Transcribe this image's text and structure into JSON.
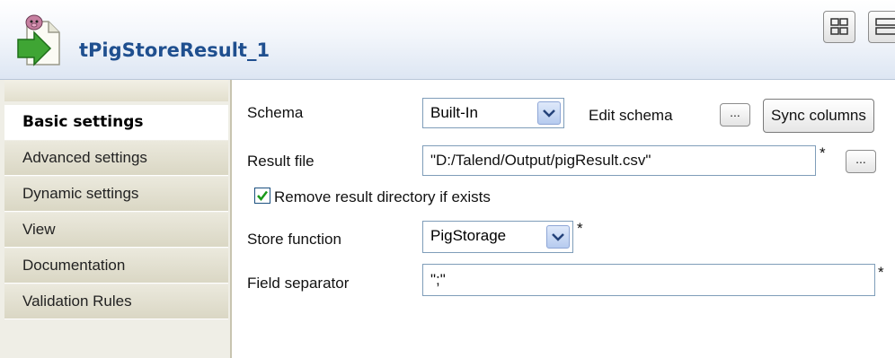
{
  "header": {
    "title": "tPigStoreResult_1",
    "icon": "pig-store-result-icon"
  },
  "sidebar": {
    "tabs": [
      {
        "label": "Basic settings",
        "active": true
      },
      {
        "label": "Advanced settings",
        "active": false
      },
      {
        "label": "Dynamic settings",
        "active": false
      },
      {
        "label": "View",
        "active": false
      },
      {
        "label": "Documentation",
        "active": false
      },
      {
        "label": "Validation Rules",
        "active": false
      }
    ]
  },
  "form": {
    "schema_label": "Schema",
    "schema_value": "Built-In",
    "edit_schema_label": "Edit schema",
    "edit_schema_button": "...",
    "sync_columns_button": "Sync columns",
    "result_file_label": "Result file",
    "result_file_value": "\"D:/Talend/Output/pigResult.csv\"",
    "result_file_required": "*",
    "result_file_browse": "...",
    "remove_dir_label": "Remove result directory if exists",
    "remove_dir_checked": true,
    "store_function_label": "Store function",
    "store_function_value": "PigStorage",
    "store_function_required": "*",
    "field_separator_label": "Field separator",
    "field_separator_value": "\";\"",
    "field_separator_required": "*"
  },
  "colors": {
    "title": "#1f4f8f",
    "sidebar_bg": "#efeee6",
    "field_border": "#7f9db9",
    "check": "#1a9a1a"
  }
}
